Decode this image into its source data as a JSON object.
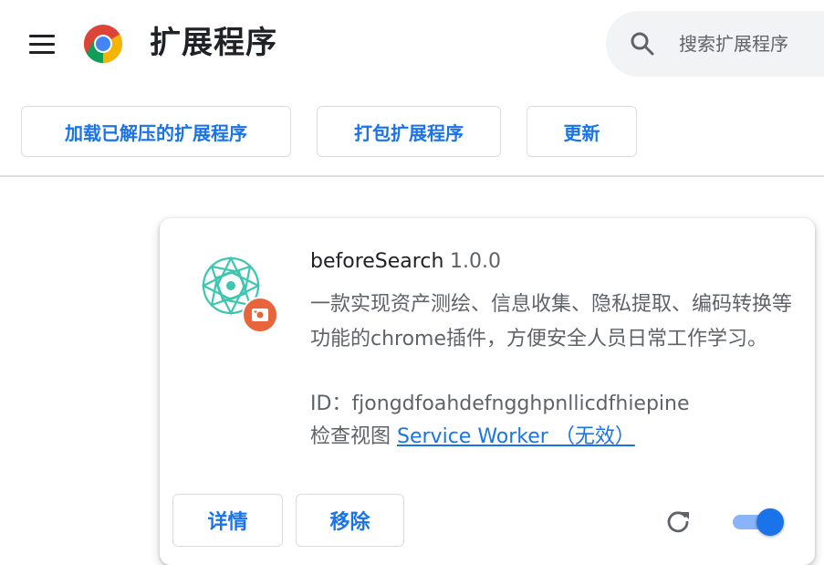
{
  "header": {
    "title": "扩展程序",
    "search_placeholder": "搜索扩展程序"
  },
  "toolbar": {
    "load_unpacked_label": "加载已解压的扩展程序",
    "pack_label": "打包扩展程序",
    "update_label": "更新"
  },
  "extension": {
    "name": "beforeSearch",
    "version": "1.0.0",
    "description": "一款实现资产测绘、信息收集、隐私提取、编码转换等功能的chrome插件，方便安全人员日常工作学习。",
    "id_label": "ID：",
    "id_value": "fjongdfoahdefngghpnllicdfhiepine",
    "views_label": "检查视图",
    "service_worker_label": "Service Worker （无效）",
    "details_label": "详情",
    "remove_label": "移除",
    "enabled": true
  },
  "colors": {
    "accent": "#1a73e8",
    "icon_teal": "#3ec6b0",
    "badge_orange": "#e8643a",
    "toggle_track": "#8ab4f8"
  },
  "icons": [
    "menu-icon",
    "chrome-logo-icon",
    "search-icon",
    "extension-icon",
    "extension-badge-icon",
    "reload-icon"
  ]
}
